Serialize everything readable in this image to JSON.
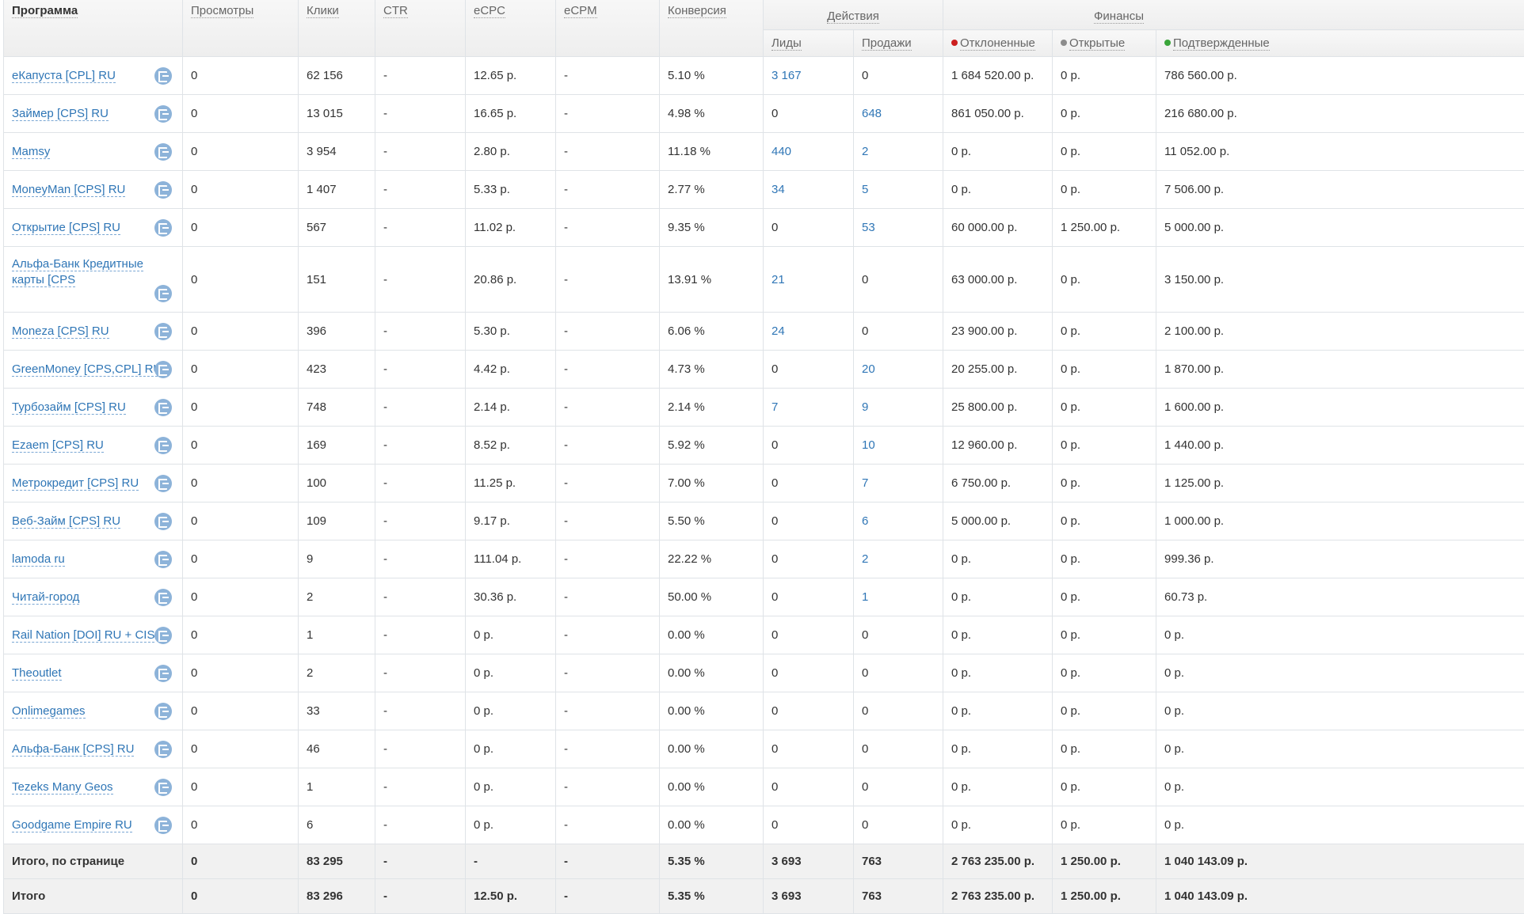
{
  "header": {
    "programma": "Программа",
    "prosmotry": "Просмотры",
    "kliki": "Клики",
    "ctr": "CTR",
    "ecpc": "eCPC",
    "ecpm": "eCPM",
    "konversiya": "Конверсия",
    "group_actions": "Действия",
    "group_finance": "Финансы",
    "lidy": "Лиды",
    "prodazhi": "Продажи",
    "otklonennye": "Отклоненные",
    "otkrytye": "Открытые",
    "podtverzhdennye": "Подтвержденные"
  },
  "colors": {
    "rejected": "#cc1f1f",
    "open": "#8c8c8c",
    "confirmed": "#3aa53a",
    "link": "#2f76b6",
    "icon": "#8db3d9"
  },
  "rows": [
    {
      "name": "еКапуста [CPL] RU",
      "views": "0",
      "clicks": "62 156",
      "ctr": "-",
      "ecpc": "12.65 р.",
      "ecpm": "-",
      "conv": "5.10 %",
      "leads": "3 167",
      "sales": "0",
      "rejected": "1 684 520.00 р.",
      "open": "0 р.",
      "confirmed": "786 560.00 р."
    },
    {
      "name": "Займер [CPS] RU",
      "views": "0",
      "clicks": "13 015",
      "ctr": "-",
      "ecpc": "16.65 р.",
      "ecpm": "-",
      "conv": "4.98 %",
      "leads": "0",
      "sales": "648",
      "rejected": "861 050.00 р.",
      "open": "0 р.",
      "confirmed": "216 680.00 р."
    },
    {
      "name": "Mamsy",
      "views": "0",
      "clicks": "3 954",
      "ctr": "-",
      "ecpc": "2.80 р.",
      "ecpm": "-",
      "conv": "11.18 %",
      "leads": "440",
      "sales": "2",
      "rejected": "0 р.",
      "open": "0 р.",
      "confirmed": "11 052.00 р."
    },
    {
      "name": "MoneyMan [CPS] RU",
      "views": "0",
      "clicks": "1 407",
      "ctr": "-",
      "ecpc": "5.33 р.",
      "ecpm": "-",
      "conv": "2.77 %",
      "leads": "34",
      "sales": "5",
      "rejected": "0 р.",
      "open": "0 р.",
      "confirmed": "7 506.00 р."
    },
    {
      "name": "Открытие [CPS] RU",
      "views": "0",
      "clicks": "567",
      "ctr": "-",
      "ecpc": "11.02 р.",
      "ecpm": "-",
      "conv": "9.35 %",
      "leads": "0",
      "sales": "53",
      "rejected": "60 000.00 р.",
      "open": "1 250.00 р.",
      "confirmed": "5 000.00 р."
    },
    {
      "name": "Альфа-Банк Кредитные карты [CPS",
      "views": "0",
      "clicks": "151",
      "ctr": "-",
      "ecpc": "20.86 р.",
      "ecpm": "-",
      "conv": "13.91 %",
      "leads": "21",
      "sales": "0",
      "rejected": "63 000.00 р.",
      "open": "0 р.",
      "confirmed": "3 150.00 р.",
      "tall": true
    },
    {
      "name": "Moneza [CPS] RU",
      "views": "0",
      "clicks": "396",
      "ctr": "-",
      "ecpc": "5.30 р.",
      "ecpm": "-",
      "conv": "6.06 %",
      "leads": "24",
      "sales": "0",
      "rejected": "23 900.00 р.",
      "open": "0 р.",
      "confirmed": "2 100.00 р."
    },
    {
      "name": "GreenMoney [CPS,CPL] RU",
      "views": "0",
      "clicks": "423",
      "ctr": "-",
      "ecpc": "4.42 р.",
      "ecpm": "-",
      "conv": "4.73 %",
      "leads": "0",
      "sales": "20",
      "rejected": "20 255.00 р.",
      "open": "0 р.",
      "confirmed": "1 870.00 р."
    },
    {
      "name": "Турбозайм [CPS] RU",
      "views": "0",
      "clicks": "748",
      "ctr": "-",
      "ecpc": "2.14 р.",
      "ecpm": "-",
      "conv": "2.14 %",
      "leads": "7",
      "sales": "9",
      "rejected": "25 800.00 р.",
      "open": "0 р.",
      "confirmed": "1 600.00 р."
    },
    {
      "name": "Ezaem [CPS] RU",
      "views": "0",
      "clicks": "169",
      "ctr": "-",
      "ecpc": "8.52 р.",
      "ecpm": "-",
      "conv": "5.92 %",
      "leads": "0",
      "sales": "10",
      "rejected": "12 960.00 р.",
      "open": "0 р.",
      "confirmed": "1 440.00 р."
    },
    {
      "name": "Метрокредит [CPS] RU",
      "views": "0",
      "clicks": "100",
      "ctr": "-",
      "ecpc": "11.25 р.",
      "ecpm": "-",
      "conv": "7.00 %",
      "leads": "0",
      "sales": "7",
      "rejected": "6 750.00 р.",
      "open": "0 р.",
      "confirmed": "1 125.00 р."
    },
    {
      "name": "Веб-Займ [CPS] RU",
      "views": "0",
      "clicks": "109",
      "ctr": "-",
      "ecpc": "9.17 р.",
      "ecpm": "-",
      "conv": "5.50 %",
      "leads": "0",
      "sales": "6",
      "rejected": "5 000.00 р.",
      "open": "0 р.",
      "confirmed": "1 000.00 р."
    },
    {
      "name": "lamoda ru",
      "views": "0",
      "clicks": "9",
      "ctr": "-",
      "ecpc": "111.04 р.",
      "ecpm": "-",
      "conv": "22.22 %",
      "leads": "0",
      "sales": "2",
      "rejected": "0 р.",
      "open": "0 р.",
      "confirmed": "999.36 р."
    },
    {
      "name": "Читай-город",
      "views": "0",
      "clicks": "2",
      "ctr": "-",
      "ecpc": "30.36 р.",
      "ecpm": "-",
      "conv": "50.00 %",
      "leads": "0",
      "sales": "1",
      "rejected": "0 р.",
      "open": "0 р.",
      "confirmed": "60.73 р."
    },
    {
      "name": "Rail Nation [DOI] RU + CIS",
      "views": "0",
      "clicks": "1",
      "ctr": "-",
      "ecpc": "0 р.",
      "ecpm": "-",
      "conv": "0.00 %",
      "leads": "0",
      "sales": "0",
      "rejected": "0 р.",
      "open": "0 р.",
      "confirmed": "0 р."
    },
    {
      "name": "Theoutlet",
      "views": "0",
      "clicks": "2",
      "ctr": "-",
      "ecpc": "0 р.",
      "ecpm": "-",
      "conv": "0.00 %",
      "leads": "0",
      "sales": "0",
      "rejected": "0 р.",
      "open": "0 р.",
      "confirmed": "0 р."
    },
    {
      "name": "Onlimegames",
      "views": "0",
      "clicks": "33",
      "ctr": "-",
      "ecpc": "0 р.",
      "ecpm": "-",
      "conv": "0.00 %",
      "leads": "0",
      "sales": "0",
      "rejected": "0 р.",
      "open": "0 р.",
      "confirmed": "0 р."
    },
    {
      "name": "Альфа-Банк [CPS] RU",
      "views": "0",
      "clicks": "46",
      "ctr": "-",
      "ecpc": "0 р.",
      "ecpm": "-",
      "conv": "0.00 %",
      "leads": "0",
      "sales": "0",
      "rejected": "0 р.",
      "open": "0 р.",
      "confirmed": "0 р."
    },
    {
      "name": "Tezeks Many Geos",
      "views": "0",
      "clicks": "1",
      "ctr": "-",
      "ecpc": "0 р.",
      "ecpm": "-",
      "conv": "0.00 %",
      "leads": "0",
      "sales": "0",
      "rejected": "0 р.",
      "open": "0 р.",
      "confirmed": "0 р."
    },
    {
      "name": "Goodgame Empire RU",
      "views": "0",
      "clicks": "6",
      "ctr": "-",
      "ecpc": "0 р.",
      "ecpm": "-",
      "conv": "0.00 %",
      "leads": "0",
      "sales": "0",
      "rejected": "0 р.",
      "open": "0 р.",
      "confirmed": "0 р."
    }
  ],
  "totals": [
    {
      "label": "Итого, по странице",
      "views": "0",
      "clicks": "83 295",
      "ctr": "-",
      "ecpc": "-",
      "ecpm": "-",
      "conv": "5.35 %",
      "leads": "3 693",
      "sales": "763",
      "rejected": "2 763 235.00 р.",
      "open": "1 250.00 р.",
      "confirmed": "1 040 143.09 р."
    },
    {
      "label": "Итого",
      "views": "0",
      "clicks": "83 296",
      "ctr": "-",
      "ecpc": "12.50 р.",
      "ecpm": "-",
      "conv": "5.35 %",
      "leads": "3 693",
      "sales": "763",
      "rejected": "2 763 235.00 р.",
      "open": "1 250.00 р.",
      "confirmed": "1 040 143.09 р."
    }
  ]
}
